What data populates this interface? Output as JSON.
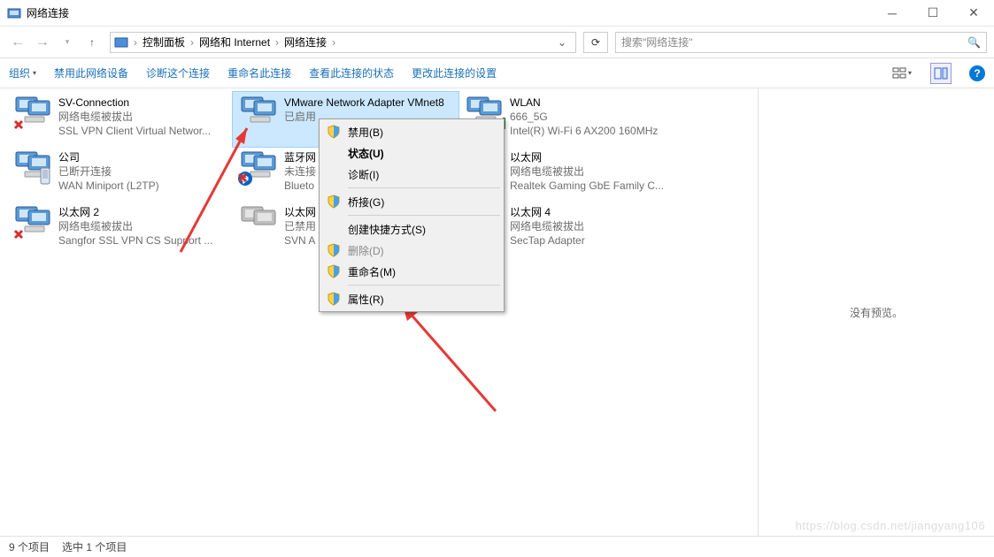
{
  "window": {
    "title": "网络连接"
  },
  "breadcrumb": {
    "items": [
      "控制面板",
      "网络和 Internet",
      "网络连接"
    ]
  },
  "search": {
    "placeholder": "搜索\"网络连接\""
  },
  "toolbar": {
    "organize": "组织",
    "disable": "禁用此网络设备",
    "diagnose": "诊断这个连接",
    "rename": "重命名此连接",
    "viewstatus": "查看此连接的状态",
    "changesettings": "更改此连接的设置"
  },
  "connections": [
    {
      "name": "SV-Connection",
      "status": "网络电缆被拔出",
      "device": "SSL VPN Client Virtual Networ...",
      "badge": "x"
    },
    {
      "name": "VMware Network Adapter VMnet8",
      "status": "已启用",
      "device": "",
      "selected": true
    },
    {
      "name": "WLAN",
      "status": "666_5G",
      "device": "Intel(R) Wi-Fi 6 AX200 160MHz",
      "badge": "signal"
    },
    {
      "name": "公司",
      "status": "已断开连接",
      "device": "WAN Miniport (L2TP)",
      "badge": "phone"
    },
    {
      "name": "蓝牙网",
      "status": "未连接",
      "device": "Blueto",
      "badge": "bt-x"
    },
    {
      "name": "以太网",
      "status": "网络电缆被拔出",
      "device": "Realtek Gaming GbE Family C...",
      "badge": "x"
    },
    {
      "name": "以太网 2",
      "status": "网络电缆被拔出",
      "device": "Sangfor SSL VPN CS Support ...",
      "badge": "x"
    },
    {
      "name": "以太网 3",
      "status": "已禁用",
      "device": "SVN A",
      "badge": "gray"
    },
    {
      "name": "以太网 4",
      "status": "网络电缆被拔出",
      "device": "SecTap Adapter",
      "badge": "x"
    }
  ],
  "contextmenu": {
    "disable": "禁用(B)",
    "status": "状态(U)",
    "diagnose": "诊断(I)",
    "bridge": "桥接(G)",
    "shortcut": "创建快捷方式(S)",
    "delete": "删除(D)",
    "rename": "重命名(M)",
    "properties": "属性(R)"
  },
  "preview": {
    "no_preview": "没有预览。"
  },
  "statusbar": {
    "count": "9 个项目",
    "selected": "选中 1 个项目"
  },
  "watermark": "https://blog.csdn.net/jiangyang106"
}
